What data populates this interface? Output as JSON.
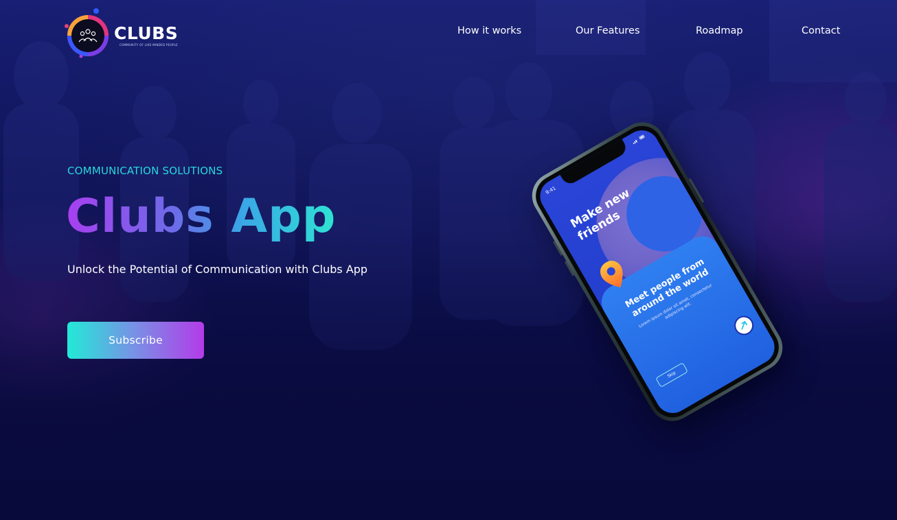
{
  "brand": {
    "name": "CLUBS",
    "tagline": "COMMUNITY OF LIKE-MINDED PEOPLE"
  },
  "nav": {
    "items": [
      {
        "label": "How it works"
      },
      {
        "label": "Our Features"
      },
      {
        "label": "Roadmap"
      },
      {
        "label": "Contact"
      }
    ]
  },
  "hero": {
    "eyebrow": "COMMUNICATION SOLUTIONS",
    "title": "Clubs App",
    "subtitle": "Unlock the Potential of Communication with Clubs App",
    "cta_label": "Subscribe"
  },
  "phone_screen": {
    "time": "9:41",
    "heading": "Make new friends",
    "card_title": "Meet people from around the world",
    "card_body": "Lorem ipsum dolor sit amet, consectetur adipiscing elit.",
    "skip_label": "Skip"
  },
  "colors": {
    "accent_cyan": "#28d8dc",
    "accent_purple": "#a83ff0",
    "background": "#0a0c44"
  },
  "icons": [
    "clubs-logo-icon",
    "location-pin-icon",
    "arrow-right-icon",
    "signal-icon",
    "wifi-icon",
    "battery-icon"
  ]
}
